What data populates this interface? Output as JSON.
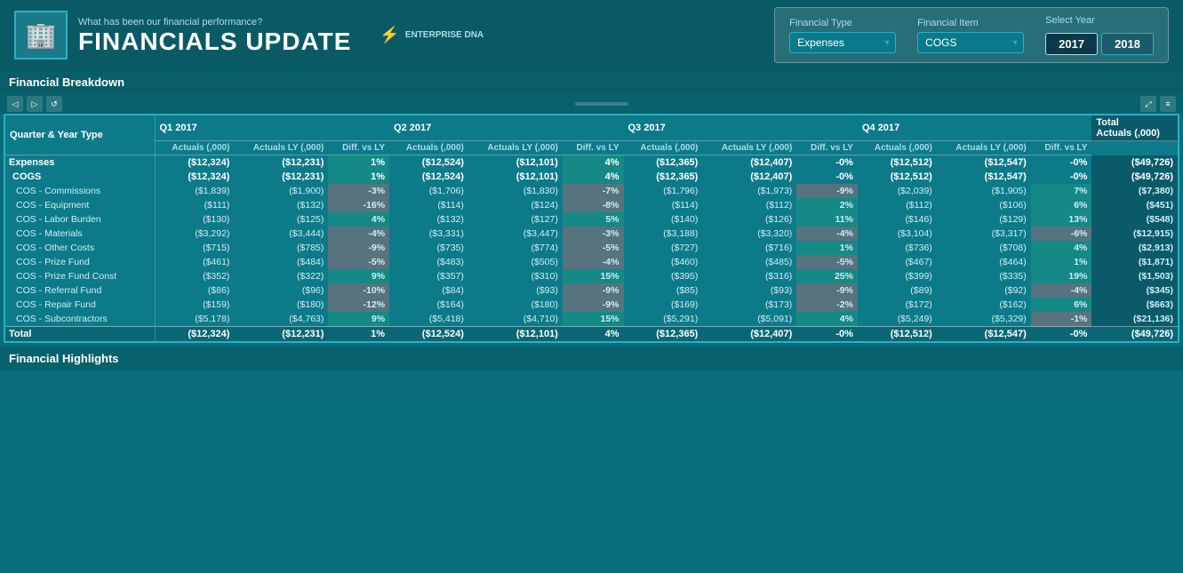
{
  "header": {
    "subtitle": "What has been our financial performance?",
    "title": "FINANCIALS UPDATE",
    "logo_text": "ENTERPRISE DNA"
  },
  "controls": {
    "financial_type_label": "Financial Type",
    "financial_type_value": "Expenses",
    "financial_item_label": "Financial Item",
    "financial_item_value": "COGS",
    "select_year_label": "Select Year",
    "year_2017": "2017",
    "year_2018": "2018"
  },
  "section_label": "Financial Breakdown",
  "table": {
    "row_label_header": "Quarter & Year Type",
    "quarters": [
      {
        "label": "Q1 2017",
        "actuals": "Actuals (,000)",
        "actuals_ly": "Actuals LY (,000)",
        "diff": "Diff. vs LY"
      },
      {
        "label": "Q2 2017",
        "actuals": "Actuals (,000)",
        "actuals_ly": "Actuals LY (,000)",
        "diff": "Diff. vs LY"
      },
      {
        "label": "Q3 2017",
        "actuals": "Actuals (,000)",
        "actuals_ly": "Actuals LY (,000)",
        "diff": "Diff. vs LY"
      },
      {
        "label": "Q4 2017",
        "actuals": "Actuals (,000)",
        "actuals_ly": "Actuals LY (,000)",
        "diff": "Diff. vs LY"
      }
    ],
    "total_header": "Total Actuals (,000)",
    "rows": [
      {
        "label": "Expenses",
        "type": "expenses",
        "q1": [
          "($12,324)",
          "($12,231)",
          "1%"
        ],
        "q2": [
          "($12,524)",
          "($12,101)",
          "4%"
        ],
        "q3": [
          "($12,365)",
          "($12,407)",
          "-0%"
        ],
        "q4": [
          "($12,512)",
          "($12,547)",
          "-0%"
        ],
        "total": "($49,726)"
      },
      {
        "label": "  COGS",
        "type": "cogs",
        "q1": [
          "($12,324)",
          "($12,231)",
          "1%"
        ],
        "q2": [
          "($12,524)",
          "($12,101)",
          "4%"
        ],
        "q3": [
          "($12,365)",
          "($12,407)",
          "-0%"
        ],
        "q4": [
          "($12,512)",
          "($12,547)",
          "-0%"
        ],
        "total": "($49,726)"
      },
      {
        "label": "    COS - Commissions",
        "type": "sub",
        "q1": [
          "($1,839)",
          "($1,900)",
          "-3%"
        ],
        "q2": [
          "($1,706)",
          "($1,830)",
          "-7%"
        ],
        "q3": [
          "($1,796)",
          "($1,973)",
          "-9%"
        ],
        "q4": [
          "($2,039)",
          "($1,905)",
          "7%"
        ],
        "total": "($7,380)"
      },
      {
        "label": "    COS - Equipment",
        "type": "sub",
        "q1": [
          "($111)",
          "($132)",
          "-16%"
        ],
        "q2": [
          "($114)",
          "($124)",
          "-8%"
        ],
        "q3": [
          "($114)",
          "($112)",
          "2%"
        ],
        "q4": [
          "($112)",
          "($106)",
          "6%"
        ],
        "total": "($451)"
      },
      {
        "label": "    COS - Labor Burden",
        "type": "sub",
        "q1": [
          "($130)",
          "($125)",
          "4%"
        ],
        "q2": [
          "($132)",
          "($127)",
          "5%"
        ],
        "q3": [
          "($140)",
          "($126)",
          "11%"
        ],
        "q4": [
          "($146)",
          "($129)",
          "13%"
        ],
        "total": "($548)"
      },
      {
        "label": "    COS - Materials",
        "type": "sub",
        "q1": [
          "($3,292)",
          "($3,444)",
          "-4%"
        ],
        "q2": [
          "($3,331)",
          "($3,447)",
          "-3%"
        ],
        "q3": [
          "($3,188)",
          "($3,320)",
          "-4%"
        ],
        "q4": [
          "($3,104)",
          "($3,317)",
          "-6%"
        ],
        "total": "($12,915)"
      },
      {
        "label": "    COS - Other Costs",
        "type": "sub",
        "q1": [
          "($715)",
          "($785)",
          "-9%"
        ],
        "q2": [
          "($735)",
          "($774)",
          "-5%"
        ],
        "q3": [
          "($727)",
          "($716)",
          "1%"
        ],
        "q4": [
          "($736)",
          "($708)",
          "4%"
        ],
        "total": "($2,913)"
      },
      {
        "label": "    COS - Prize Fund",
        "type": "sub",
        "q1": [
          "($461)",
          "($484)",
          "-5%"
        ],
        "q2": [
          "($483)",
          "($505)",
          "-4%"
        ],
        "q3": [
          "($460)",
          "($485)",
          "-5%"
        ],
        "q4": [
          "($467)",
          "($464)",
          "1%"
        ],
        "total": "($1,871)"
      },
      {
        "label": "    COS - Prize Fund Const",
        "type": "sub",
        "q1": [
          "($352)",
          "($322)",
          "9%"
        ],
        "q2": [
          "($357)",
          "($310)",
          "15%"
        ],
        "q3": [
          "($395)",
          "($316)",
          "25%"
        ],
        "q4": [
          "($399)",
          "($335)",
          "19%"
        ],
        "total": "($1,503)"
      },
      {
        "label": "    COS - Referral Fund",
        "type": "sub",
        "q1": [
          "($86)",
          "($96)",
          "-10%"
        ],
        "q2": [
          "($84)",
          "($93)",
          "-9%"
        ],
        "q3": [
          "($85)",
          "($93)",
          "-9%"
        ],
        "q4": [
          "($89)",
          "($92)",
          "-4%"
        ],
        "total": "($345)"
      },
      {
        "label": "    COS - Repair Fund",
        "type": "sub",
        "q1": [
          "($159)",
          "($180)",
          "-12%"
        ],
        "q2": [
          "($164)",
          "($180)",
          "-9%"
        ],
        "q3": [
          "($169)",
          "($173)",
          "-2%"
        ],
        "q4": [
          "($172)",
          "($162)",
          "6%"
        ],
        "total": "($663)"
      },
      {
        "label": "    COS - Subcontractors",
        "type": "sub",
        "q1": [
          "($5,178)",
          "($4,763)",
          "9%"
        ],
        "q2": [
          "($5,418)",
          "($4,710)",
          "15%"
        ],
        "q3": [
          "($5,291)",
          "($5,091)",
          "4%"
        ],
        "q4": [
          "($5,249)",
          "($5,329)",
          "-1%"
        ],
        "total": "($21,136)"
      },
      {
        "label": "Total",
        "type": "total",
        "q1": [
          "($12,324)",
          "($12,231)",
          "1%"
        ],
        "q2": [
          "($12,524)",
          "($12,101)",
          "4%"
        ],
        "q3": [
          "($12,365)",
          "($12,407)",
          "-0%"
        ],
        "q4": [
          "($12,512)",
          "($12,547)",
          "-0%"
        ],
        "total": "($49,726)"
      }
    ]
  },
  "bottom_section": "Financial Highlights"
}
